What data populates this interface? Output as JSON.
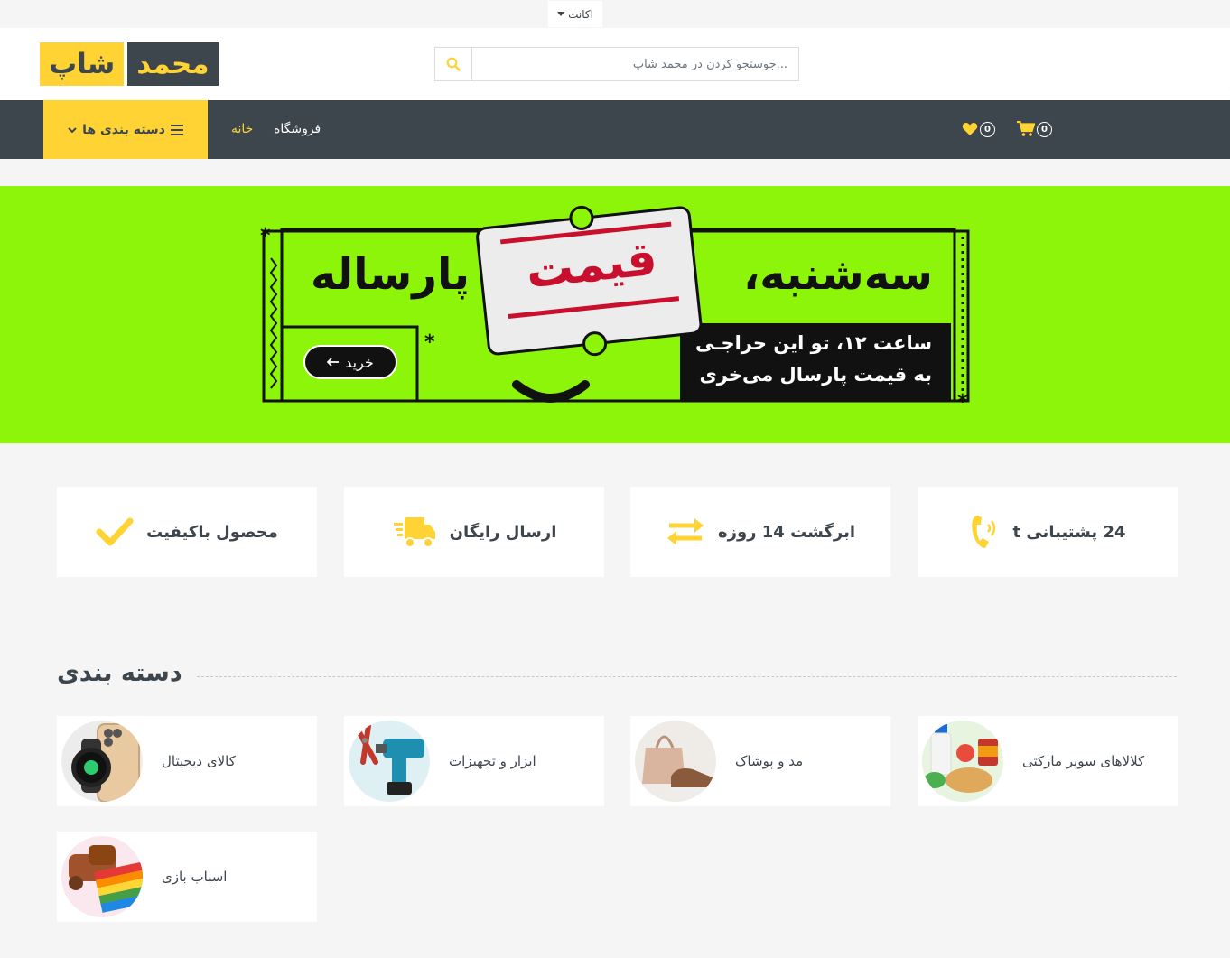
{
  "topbar": {
    "account_label": "اکانت"
  },
  "header": {
    "logo_part1": "محمد",
    "logo_part2": "شاپ",
    "search_placeholder": "...جوستجو کردن در محمد شاپ"
  },
  "nav": {
    "categories_label": "دسته بندی ها",
    "links": [
      "خانه",
      "فروشگاه"
    ],
    "wishlist_count": "0",
    "cart_count": "0"
  },
  "banner": {
    "headline_right": "سه‌شنبه،",
    "headline_tag": "قیمت",
    "headline_left": "پارساله",
    "subtitle_line1": "ساعت ۱۲، تو این حراجـی",
    "subtitle_line2": "به قیمت پارسال می‌خری",
    "button_label": "خرید"
  },
  "features": [
    {
      "label": "محصول باکیفیت",
      "icon": "check-icon"
    },
    {
      "label": "ارسال رایگان",
      "icon": "shipping-fast-icon"
    },
    {
      "label": "ابرگشت 14 روزه",
      "icon": "exchange-icon"
    },
    {
      "label": "24 پشتیبانی t",
      "icon": "phone-volume-icon"
    }
  ],
  "categories": {
    "title": "دسته بندی",
    "items": [
      {
        "label": "کالای دیجیتال",
        "image": "smartwatch-phone-image"
      },
      {
        "label": "ابزار و تجهیزات",
        "image": "drill-tools-image"
      },
      {
        "label": "مد و پوشاک",
        "image": "bag-shoes-image"
      },
      {
        "label": "کلالاهای سوپر مارکتی",
        "image": "grocery-image"
      },
      {
        "label": "اسباب بازی",
        "image": "toys-image"
      }
    ]
  },
  "colors": {
    "primary": "#ffd333",
    "dark": "#3d464d",
    "banner_green": "#8cf50a",
    "page_bg": "#f5f5f5"
  }
}
